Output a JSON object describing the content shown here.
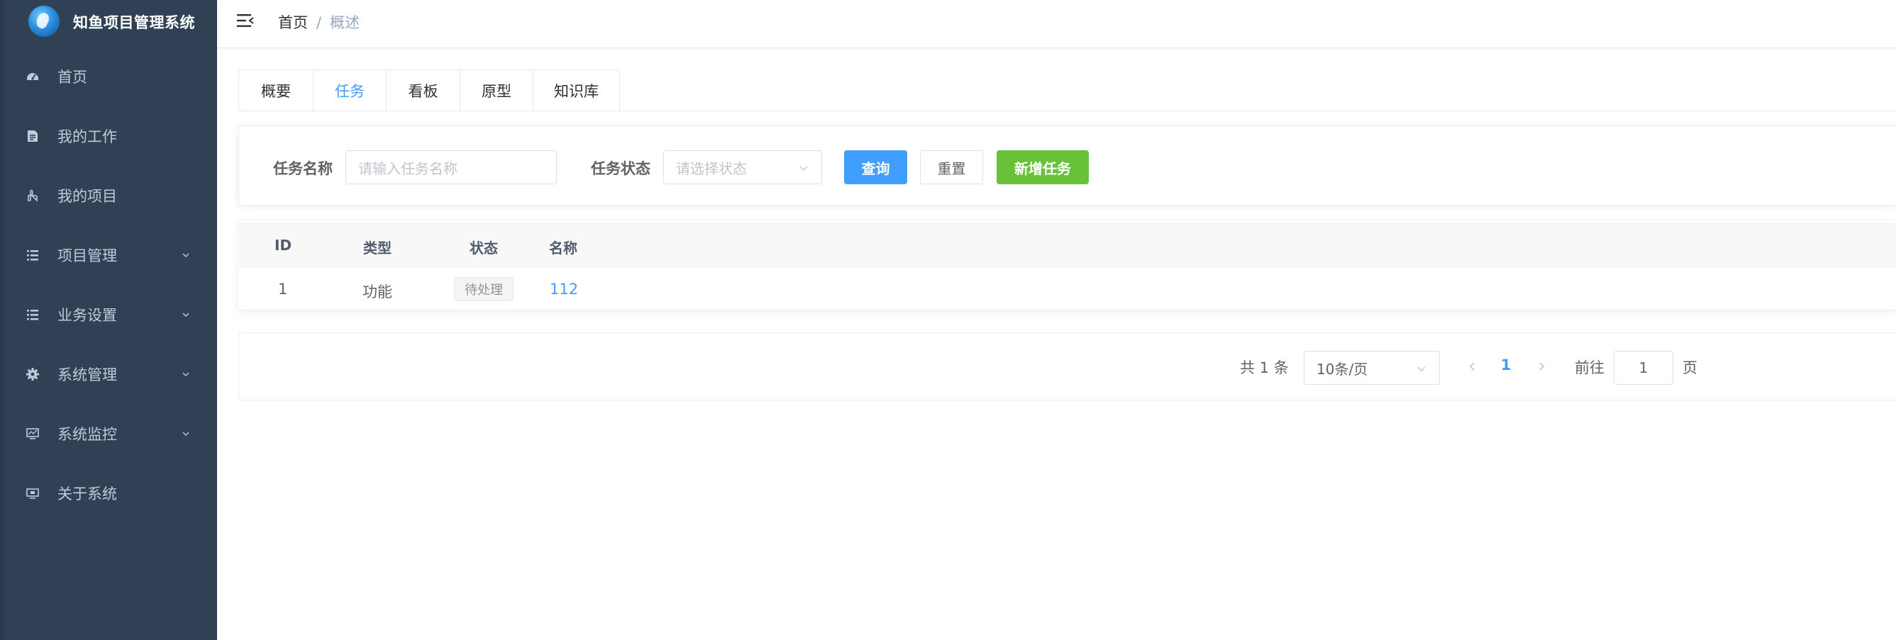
{
  "app": {
    "title": "知鱼项目管理系统"
  },
  "sidebar": {
    "items": [
      {
        "label": "首页",
        "icon": "dashboard-icon",
        "has_submenu": false
      },
      {
        "label": "我的工作",
        "icon": "document-icon",
        "has_submenu": false
      },
      {
        "label": "我的项目",
        "icon": "hand-pointer-icon",
        "has_submenu": false
      },
      {
        "label": "项目管理",
        "icon": "list-icon",
        "has_submenu": true
      },
      {
        "label": "业务设置",
        "icon": "list-icon",
        "has_submenu": true
      },
      {
        "label": "系统管理",
        "icon": "gear-icon",
        "has_submenu": true
      },
      {
        "label": "系统监控",
        "icon": "monitor-icon",
        "has_submenu": true
      },
      {
        "label": "关于系统",
        "icon": "screen-icon",
        "has_submenu": false
      }
    ]
  },
  "header": {
    "breadcrumb": {
      "home": "首页",
      "separator": "/",
      "current": "概述"
    }
  },
  "tabs": [
    {
      "label": "概要",
      "active": false
    },
    {
      "label": "任务",
      "active": true
    },
    {
      "label": "看板",
      "active": false
    },
    {
      "label": "原型",
      "active": false
    },
    {
      "label": "知识库",
      "active": false
    }
  ],
  "search": {
    "name_label": "任务名称",
    "name_placeholder": "请输入任务名称",
    "status_label": "任务状态",
    "status_placeholder": "请选择状态",
    "query_button": "查询",
    "reset_button": "重置",
    "add_button": "新增任务"
  },
  "table": {
    "headers": {
      "id": "ID",
      "type": "类型",
      "status": "状态",
      "name": "名称"
    },
    "rows": [
      {
        "id": "1",
        "type": "功能",
        "status": "待处理",
        "name": "112"
      }
    ]
  },
  "pagination": {
    "total": "共 1 条",
    "page_size": "10条/页",
    "current_page": "1",
    "goto_label": "前往",
    "goto_value": "1",
    "page_suffix": "页"
  },
  "colors": {
    "sidebar_bg": "#304156",
    "primary": "#409eff",
    "success": "#67c23a"
  }
}
